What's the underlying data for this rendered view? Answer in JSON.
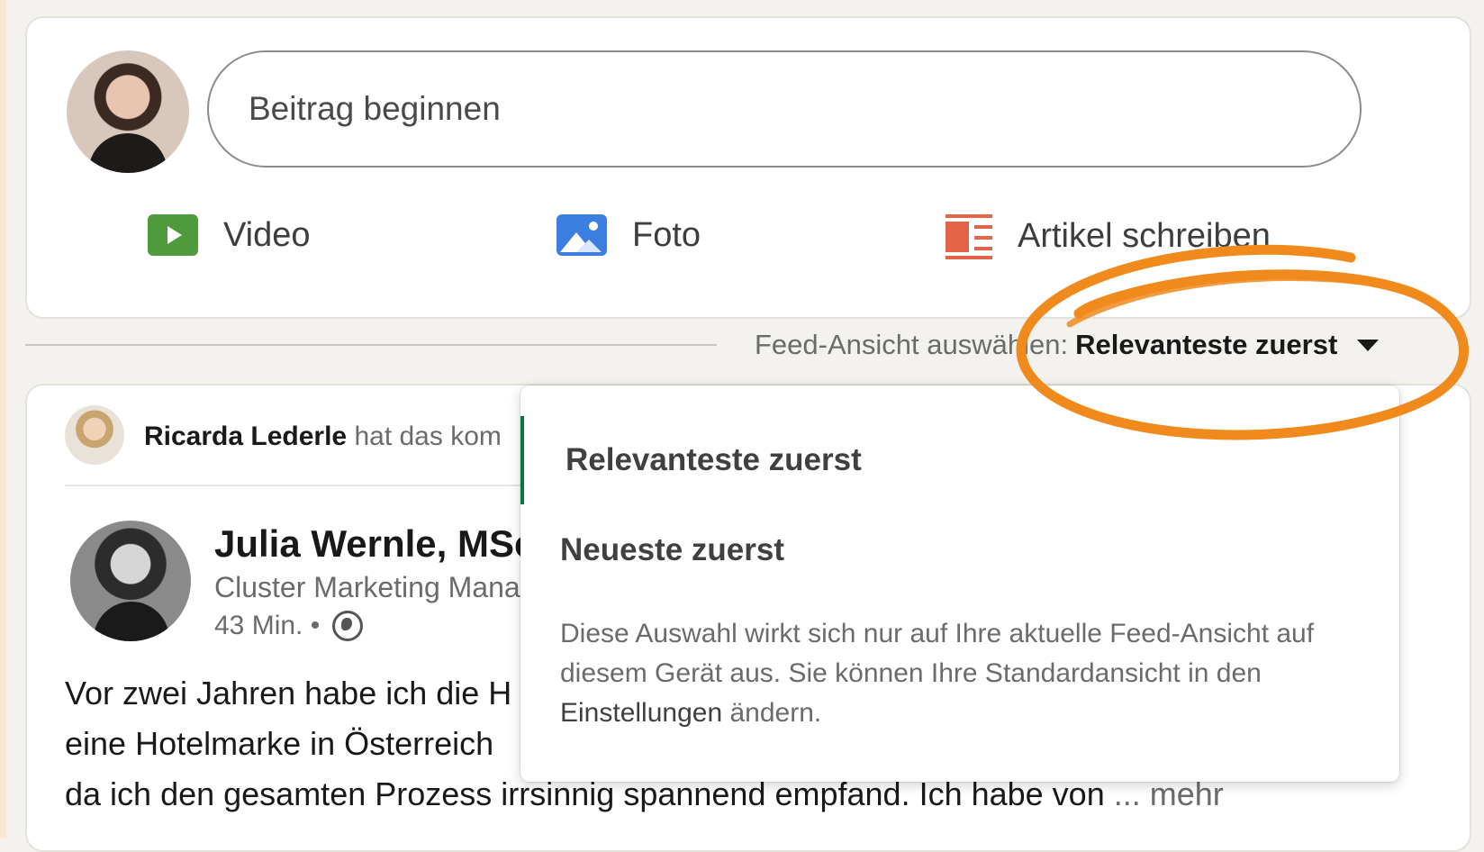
{
  "composer": {
    "placeholder": "Beitrag beginnen",
    "actions": [
      {
        "label": "Video",
        "icon": "video-icon",
        "color": "#4e9a3c"
      },
      {
        "label": "Foto",
        "icon": "photo-icon",
        "color": "#3d7fe0"
      },
      {
        "label": "Artikel schreiben",
        "icon": "article-icon",
        "color": "#e2654a"
      }
    ]
  },
  "sort": {
    "label": "Feed-Ansicht auswählen:",
    "value": "Relevanteste zuerst"
  },
  "post": {
    "actor_name": "Ricarda Lederle",
    "actor_action": "hat das kom",
    "author_name": "Julia Wernle, MSc",
    "author_role": "Cluster Marketing Mana",
    "time": "43 Min. •",
    "text_lines": [
      "Vor zwei Jahren habe ich die H",
      "eine Hotelmarke in Österreich",
      "da ich den gesamten Prozess irrsinnig spannend empfand. Ich habe von"
    ],
    "more": "... mehr"
  },
  "dropdown": {
    "options": [
      "Relevanteste zuerst",
      "Neueste zuerst"
    ],
    "hint_before": "Diese Auswahl wirkt sich nur auf Ihre aktuelle Feed-Ansicht auf diesem Gerät aus. Sie können Ihre Standardansicht in den ",
    "hint_link": "Einstellungen",
    "hint_after": " ändern."
  },
  "colors": {
    "accent_green": "#057642",
    "annotation_orange": "#f08a1c"
  }
}
